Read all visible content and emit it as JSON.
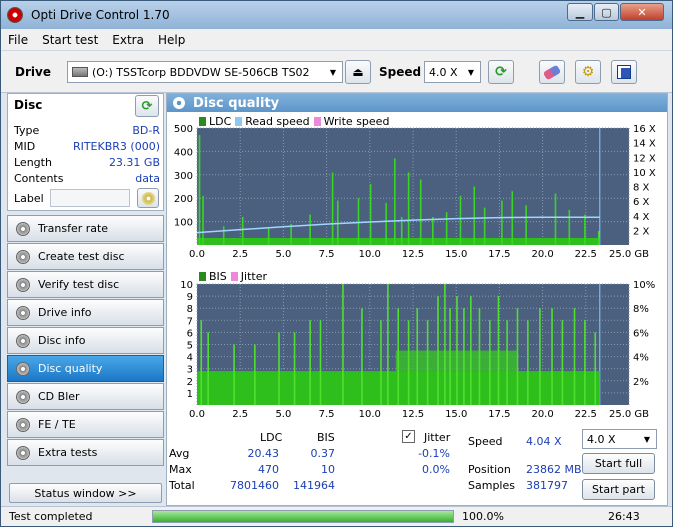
{
  "app": {
    "title": "Opti Drive Control 1.70"
  },
  "menu": [
    "File",
    "Start test",
    "Extra",
    "Help"
  ],
  "toolbar": {
    "drive_label": "Drive",
    "drive_value": "(O:)  TSSTcorp BDDVDW SE-506CB TS02",
    "speed_label": "Speed",
    "speed_value": "4.0 X"
  },
  "disc": {
    "header": "Disc",
    "rows": [
      {
        "k": "Type",
        "v": "BD-R"
      },
      {
        "k": "MID",
        "v": "RITEKBR3 (000)"
      },
      {
        "k": "Length",
        "v": "23.31 GB"
      },
      {
        "k": "Contents",
        "v": "data"
      }
    ],
    "label_key": "Label",
    "label_value": ""
  },
  "nav": [
    "Transfer rate",
    "Create test disc",
    "Verify test disc",
    "Drive info",
    "Disc info",
    "Disc quality",
    "CD Bler",
    "FE / TE",
    "Extra tests"
  ],
  "nav_active": "Disc quality",
  "status_window": "Status window >>",
  "panel_title": "Disc quality",
  "chart_data": [
    {
      "type": "bar",
      "legend": [
        "LDC",
        "Read speed",
        "Write speed"
      ],
      "colors": {
        "LDC": "#2a8a1e",
        "Read speed": "#8cc8f0",
        "Write speed": "#ee88dd"
      },
      "x_ticks": [
        "0.0",
        "2.5",
        "5.0",
        "7.5",
        "10.0",
        "12.5",
        "15.0",
        "17.5",
        "20.0",
        "22.5",
        "25.0 GB"
      ],
      "xlim": [
        0,
        25
      ],
      "y_ticks": [
        "500",
        "400",
        "300",
        "200",
        "100"
      ],
      "ylim": [
        0,
        500
      ],
      "y2_ticks": [
        "16 X",
        "14 X",
        "12 X",
        "10 X",
        "8 X",
        "6 X",
        "4 X",
        "2 X"
      ],
      "y2lim": [
        0,
        16
      ],
      "end_gb": 23.31,
      "ldc_baseline": 30,
      "ldc_spikes": [
        [
          0.1,
          470
        ],
        [
          0.3,
          210
        ],
        [
          1.5,
          80
        ],
        [
          2.6,
          120
        ],
        [
          4.1,
          70
        ],
        [
          5.4,
          90
        ],
        [
          6.5,
          130
        ],
        [
          7.8,
          310
        ],
        [
          8.1,
          190
        ],
        [
          9.3,
          200
        ],
        [
          10.0,
          260
        ],
        [
          10.9,
          180
        ],
        [
          11.4,
          370
        ],
        [
          11.8,
          120
        ],
        [
          12.2,
          310
        ],
        [
          12.9,
          280
        ],
        [
          13.6,
          120
        ],
        [
          14.4,
          140
        ],
        [
          15.2,
          210
        ],
        [
          16.0,
          250
        ],
        [
          16.6,
          160
        ],
        [
          17.6,
          190
        ],
        [
          18.2,
          230
        ],
        [
          19.0,
          170
        ],
        [
          20.7,
          220
        ],
        [
          21.5,
          150
        ],
        [
          22.4,
          130
        ],
        [
          23.2,
          60
        ]
      ],
      "read_speed": [
        [
          0,
          1.7
        ],
        [
          2.5,
          2.1
        ],
        [
          5,
          2.5
        ],
        [
          7.5,
          2.85
        ],
        [
          10,
          3.15
        ],
        [
          12.5,
          3.4
        ],
        [
          15,
          3.6
        ],
        [
          17.5,
          3.75
        ],
        [
          20,
          3.8
        ],
        [
          23.3,
          3.8
        ]
      ]
    },
    {
      "type": "bar",
      "legend": [
        "BIS",
        "Jitter"
      ],
      "colors": {
        "BIS": "#2a8a1e",
        "Jitter": "#ee88dd"
      },
      "x_ticks": [
        "0.0",
        "2.5",
        "5.0",
        "7.5",
        "10.0",
        "12.5",
        "15.0",
        "17.5",
        "20.0",
        "22.5",
        "25.0 GB"
      ],
      "xlim": [
        0,
        25
      ],
      "y_ticks": [
        "10",
        "9",
        "8",
        "7",
        "6",
        "5",
        "4",
        "3",
        "2",
        "1"
      ],
      "ylim": [
        0,
        10
      ],
      "y2_ticks": [
        "10%",
        "8%",
        "6%",
        "4%",
        "2%"
      ],
      "y2lim": [
        0,
        10
      ],
      "end_gb": 23.31,
      "bis_spikes": [
        [
          0.2,
          7
        ],
        [
          0.6,
          6
        ],
        [
          2.1,
          5
        ],
        [
          3.3,
          5
        ],
        [
          4.7,
          6
        ],
        [
          5.6,
          6
        ],
        [
          6.5,
          7
        ],
        [
          7.1,
          7
        ],
        [
          8.4,
          10
        ],
        [
          9.5,
          8
        ],
        [
          10.6,
          7
        ],
        [
          11.0,
          10
        ],
        [
          11.6,
          8
        ],
        [
          12.2,
          7
        ],
        [
          12.7,
          8
        ],
        [
          13.3,
          7
        ],
        [
          13.9,
          9
        ],
        [
          14.3,
          10
        ],
        [
          14.6,
          8
        ],
        [
          15.0,
          9
        ],
        [
          15.4,
          8
        ],
        [
          15.8,
          9
        ],
        [
          16.3,
          8
        ],
        [
          16.9,
          7
        ],
        [
          17.4,
          9
        ],
        [
          17.9,
          7
        ],
        [
          18.5,
          8
        ],
        [
          19.1,
          7
        ],
        [
          19.8,
          8
        ],
        [
          20.5,
          8
        ],
        [
          21.1,
          7
        ],
        [
          21.8,
          8
        ],
        [
          22.4,
          7
        ],
        [
          23.0,
          6
        ]
      ]
    }
  ],
  "stats": {
    "col_ldc": "LDC",
    "col_bis": "BIS",
    "jitter_label": "Jitter",
    "avg_label": "Avg",
    "avg_ldc": "20.43",
    "avg_bis": "0.37",
    "avg_jit": "-0.1%",
    "max_label": "Max",
    "max_ldc": "470",
    "max_bis": "10",
    "max_jit": "0.0%",
    "total_label": "Total",
    "total_ldc": "7801460",
    "total_bis": "141964",
    "speed_label": "Speed",
    "speed_val": "4.04 X",
    "position_label": "Position",
    "position_val": "23862 MB",
    "samples_label": "Samples",
    "samples_val": "381797",
    "speed_select": "4.0 X",
    "start_full": "Start full",
    "start_part": "Start part"
  },
  "status": {
    "text": "Test completed",
    "percent": "100.0%",
    "progress": 1.0,
    "time": "26:43"
  }
}
